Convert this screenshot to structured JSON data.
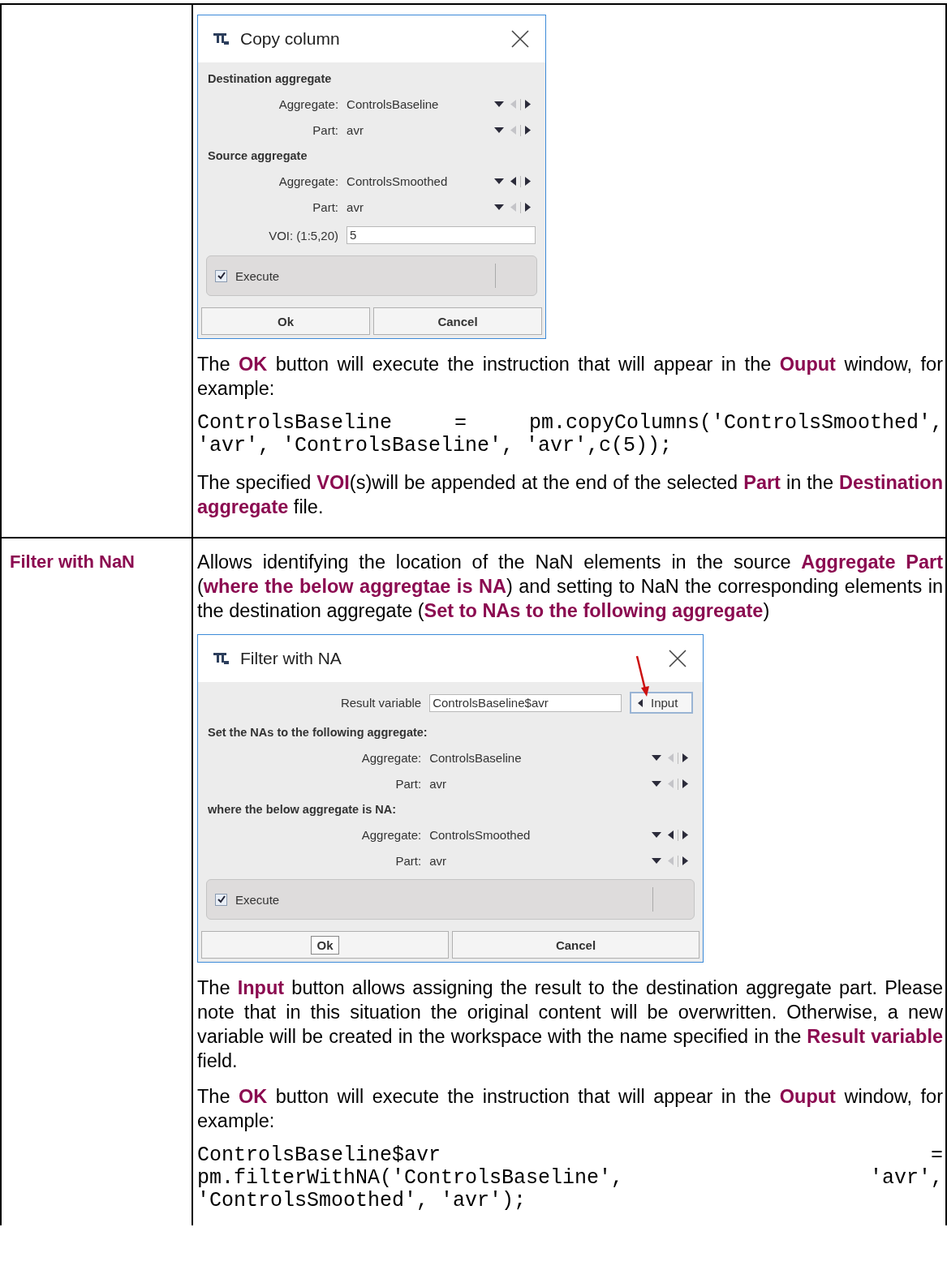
{
  "table": {
    "rows": [
      {
        "heading": "",
        "blocks": [
          {
            "kind": "dialog",
            "title": "Copy column",
            "rows": [
              {
                "kind": "section",
                "text": "Destination aggregate"
              },
              {
                "kind": "selector",
                "label": "Aggregate:",
                "value": "ControlsBaseline",
                "prev_enabled": false
              },
              {
                "kind": "selector",
                "label": "Part:",
                "value": "avr",
                "prev_enabled": false
              },
              {
                "kind": "section",
                "text": "Source aggregate"
              },
              {
                "kind": "selector",
                "label": "Aggregate:",
                "value": "ControlsSmoothed",
                "prev_enabled": true
              },
              {
                "kind": "selector",
                "label": "Part:",
                "value": "avr",
                "prev_enabled": false
              },
              {
                "kind": "field",
                "label": "VOI: (1:5,20)",
                "value": "5"
              }
            ],
            "execute": {
              "label": "Execute",
              "checked": true
            },
            "buttons": [
              {
                "label": "Ok",
                "focused": false
              },
              {
                "label": "Cancel",
                "focused": false
              }
            ]
          },
          {
            "kind": "paragraph",
            "text": "The **OK** button will execute the instruction that will appear in the **Ouput** window, for example:"
          },
          {
            "kind": "code",
            "lines": [
              "ControlsBaseline = pm.copyColumns('ControlsSmoothed',",
              "'avr', 'ControlsBaseline', 'avr',c(5));"
            ]
          },
          {
            "kind": "paragraph",
            "text": "The specified **VOI**(s)will be appended at the end of the selected **Part** in the **Destination aggregate** file."
          }
        ]
      },
      {
        "heading": "Filter with NaN",
        "blocks": [
          {
            "kind": "paragraph",
            "text": "Allows identifying the location of the NaN elements in the source **Aggregate Part** (**where the below aggregtae is NA**) and setting to NaN the corresponding elements in the destination aggregate (**Set to NAs to the following aggregate**)"
          },
          {
            "kind": "dialog",
            "title": "Filter with NA",
            "rows": [
              {
                "kind": "result",
                "label": "Result variable",
                "value": "ControlsBaseline$avr",
                "button": "Input",
                "arrow_marked": true
              },
              {
                "kind": "section",
                "text": "Set the NAs to the following aggregate:"
              },
              {
                "kind": "selector",
                "label": "Aggregate:",
                "value": "ControlsBaseline",
                "prev_enabled": false
              },
              {
                "kind": "selector",
                "label": "Part:",
                "value": "avr",
                "prev_enabled": false
              },
              {
                "kind": "section",
                "text": "where the below aggregate is NA:"
              },
              {
                "kind": "selector",
                "label": "Aggregate:",
                "value": "ControlsSmoothed",
                "prev_enabled": true
              },
              {
                "kind": "selector",
                "label": "Part:",
                "value": "avr",
                "prev_enabled": false
              }
            ],
            "execute": {
              "label": "Execute",
              "checked": true
            },
            "buttons": [
              {
                "label": "Ok",
                "focused": true
              },
              {
                "label": "Cancel",
                "focused": false
              }
            ]
          },
          {
            "kind": "paragraph",
            "text": "The **Input** button allows assigning the result to the destination aggregate part. Please note that in this situation the original content will be overwritten. Otherwise, a new variable will be created in the workspace with the name specified in the **Result variable** field."
          },
          {
            "kind": "paragraph",
            "text": "The **OK** button will execute the instruction that will appear in the **Ouput** window, for example:"
          },
          {
            "kind": "code",
            "lines": [
              "ControlsBaseline$avr =",
              "pm.filterWithNA('ControlsBaseline', 'avr',",
              "'ControlsSmoothed', 'avr');"
            ]
          }
        ]
      }
    ]
  }
}
